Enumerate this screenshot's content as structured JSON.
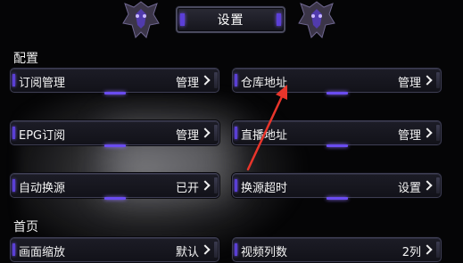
{
  "header": {
    "title": "设置"
  },
  "sections": {
    "config": "配置",
    "home": "首页"
  },
  "items": {
    "subscription": {
      "label": "订阅管理",
      "value": "管理"
    },
    "warehouse": {
      "label": "仓库地址",
      "value": "管理"
    },
    "epg": {
      "label": "EPG订阅",
      "value": "管理"
    },
    "live": {
      "label": "直播地址",
      "value": "管理"
    },
    "auto_switch": {
      "label": "自动换源",
      "value": "已开"
    },
    "switch_timeout": {
      "label": "换源超时",
      "value": "设置"
    },
    "scale": {
      "label": "画面缩放",
      "value": "默认"
    },
    "columns": {
      "label": "视频列数",
      "value": "2列"
    }
  },
  "colors": {
    "accent": "#6a4cf0",
    "annotation_arrow": "#e8352b"
  },
  "icons": [
    "emblem-left-icon",
    "emblem-right-icon",
    "chevron-right-icon",
    "annotation-arrow"
  ]
}
